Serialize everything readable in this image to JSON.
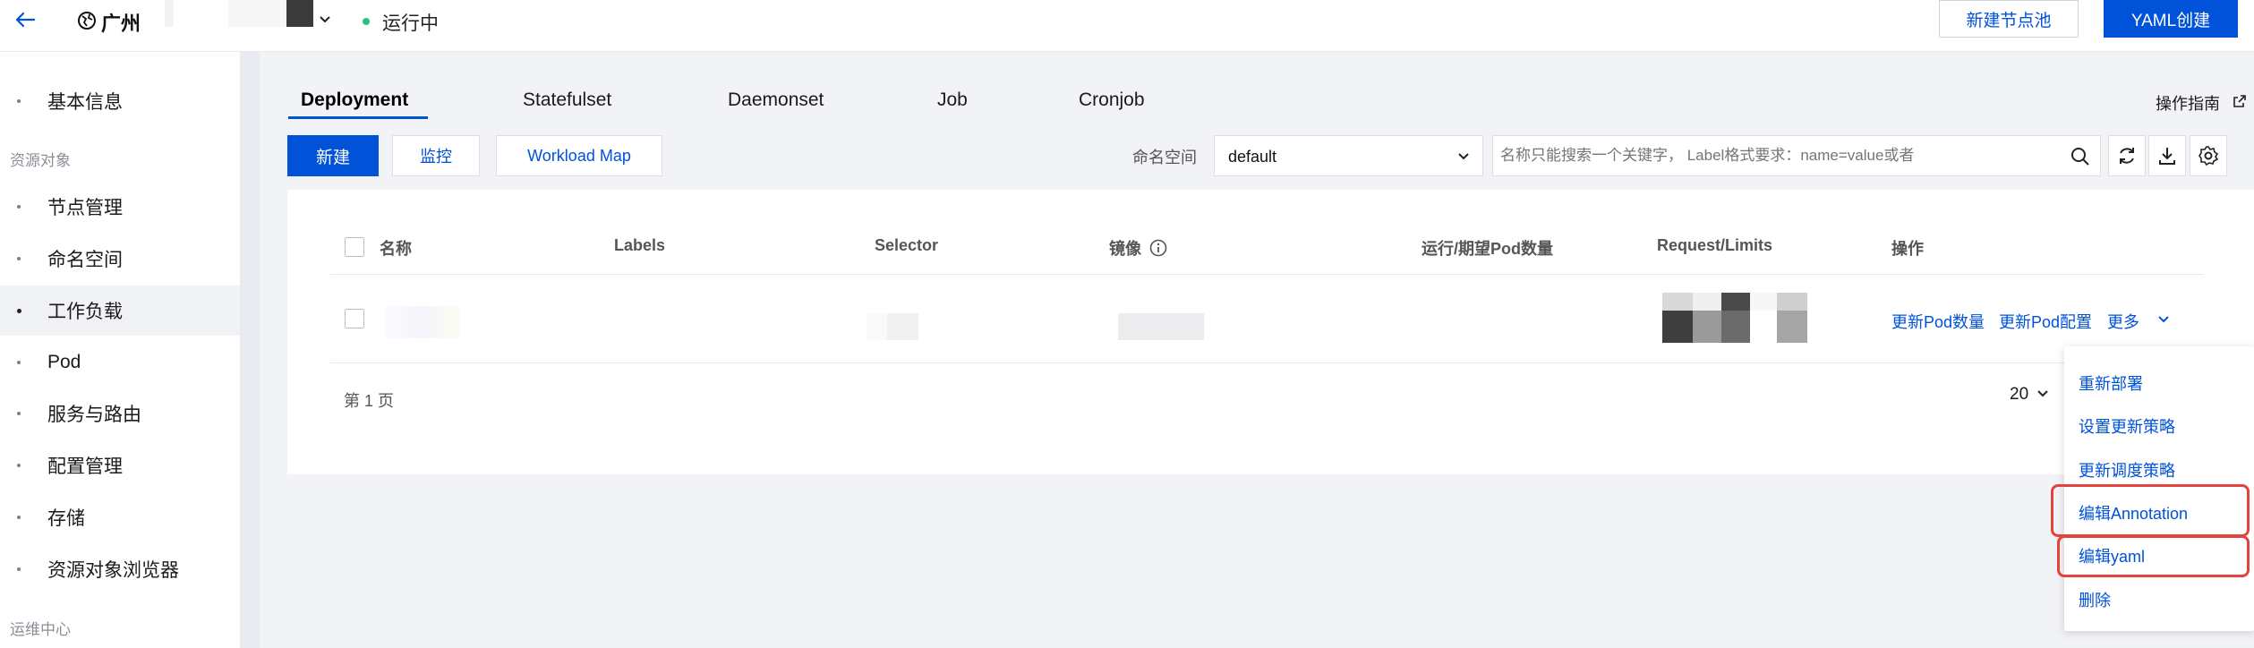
{
  "topbar": {
    "region": "广州",
    "status": "运行中",
    "new_nodepool_label": "新建节点池",
    "yaml_create_label": "YAML创建"
  },
  "sidebar": {
    "items": [
      {
        "label": "基本信息"
      },
      {
        "label": "节点管理"
      },
      {
        "label": "命名空间"
      },
      {
        "label": "工作负载"
      },
      {
        "label": "Pod"
      },
      {
        "label": "服务与路由"
      },
      {
        "label": "配置管理"
      },
      {
        "label": "存储"
      },
      {
        "label": "资源对象浏览器"
      }
    ],
    "groups": {
      "resources": "资源对象",
      "ops": "运维中心"
    },
    "active": "工作负载"
  },
  "tabs": [
    {
      "label": "Deployment"
    },
    {
      "label": "Statefulset"
    },
    {
      "label": "Daemonset"
    },
    {
      "label": "Job"
    },
    {
      "label": "Cronjob"
    }
  ],
  "guide_label": "操作指南",
  "toolbar": {
    "new_label": "新建",
    "monitor_label": "监控",
    "workload_map_label": "Workload Map",
    "namespace_label": "命名空间",
    "namespace_value": "default",
    "search_placeholder": "名称只能搜索一个关键字， Label格式要求：name=value或者"
  },
  "table": {
    "columns": [
      "名称",
      "Labels",
      "Selector",
      "镜像",
      "运行/期望Pod数量",
      "Request/Limits",
      "操作"
    ],
    "row_actions": {
      "update_pod_count": "更新Pod数量",
      "update_pod_config": "更新Pod配置",
      "more": "更多"
    }
  },
  "pagination": {
    "page_text": "第 1 页",
    "page_size": "20"
  },
  "dropdown": {
    "items": [
      "重新部署",
      "设置更新策略",
      "更新调度策略",
      "编辑Annotation",
      "编辑yaml",
      "删除"
    ]
  },
  "colors": {
    "primary": "#0052d9",
    "status_running": "#2fc184",
    "highlight": "#e3433c"
  }
}
